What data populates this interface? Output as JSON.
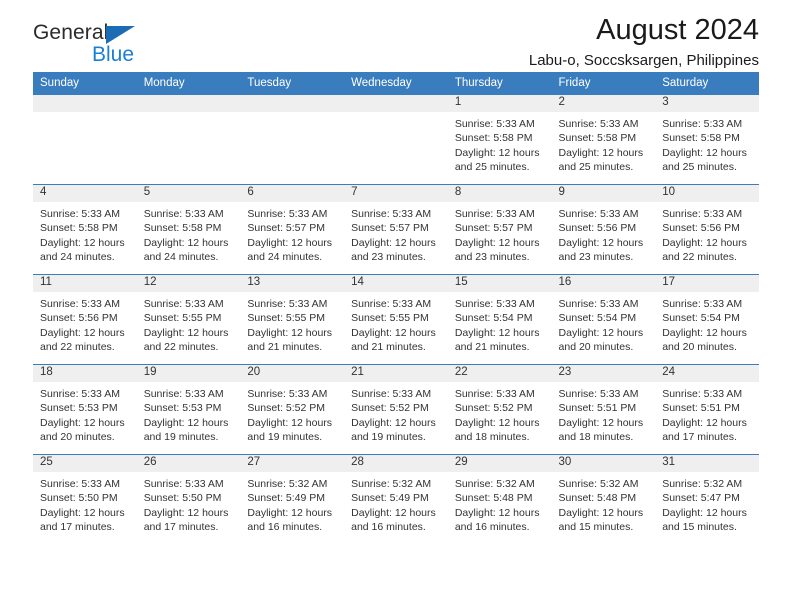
{
  "brand": {
    "name_top": "General",
    "name_bottom": "Blue",
    "triangle_color": "#1b6cb5",
    "blue_text_color": "#1b7fd4"
  },
  "header": {
    "title": "August 2024",
    "subtitle": "Labu-o, Soccsksargen, Philippines"
  },
  "theme": {
    "header_row_bg": "#3a7dbf",
    "daynum_bg": "#efefef",
    "text_color": "#333333"
  },
  "weekday_headers": [
    "Sunday",
    "Monday",
    "Tuesday",
    "Wednesday",
    "Thursday",
    "Friday",
    "Saturday"
  ],
  "weeks": [
    [
      {
        "day": "",
        "empty": true
      },
      {
        "day": "",
        "empty": true
      },
      {
        "day": "",
        "empty": true
      },
      {
        "day": "",
        "empty": true
      },
      {
        "day": "1",
        "sunrise": "Sunrise: 5:33 AM",
        "sunset": "Sunset: 5:58 PM",
        "daylight_line1": "Daylight: 12 hours",
        "daylight_line2": "and 25 minutes."
      },
      {
        "day": "2",
        "sunrise": "Sunrise: 5:33 AM",
        "sunset": "Sunset: 5:58 PM",
        "daylight_line1": "Daylight: 12 hours",
        "daylight_line2": "and 25 minutes."
      },
      {
        "day": "3",
        "sunrise": "Sunrise: 5:33 AM",
        "sunset": "Sunset: 5:58 PM",
        "daylight_line1": "Daylight: 12 hours",
        "daylight_line2": "and 25 minutes."
      }
    ],
    [
      {
        "day": "4",
        "sunrise": "Sunrise: 5:33 AM",
        "sunset": "Sunset: 5:58 PM",
        "daylight_line1": "Daylight: 12 hours",
        "daylight_line2": "and 24 minutes."
      },
      {
        "day": "5",
        "sunrise": "Sunrise: 5:33 AM",
        "sunset": "Sunset: 5:58 PM",
        "daylight_line1": "Daylight: 12 hours",
        "daylight_line2": "and 24 minutes."
      },
      {
        "day": "6",
        "sunrise": "Sunrise: 5:33 AM",
        "sunset": "Sunset: 5:57 PM",
        "daylight_line1": "Daylight: 12 hours",
        "daylight_line2": "and 24 minutes."
      },
      {
        "day": "7",
        "sunrise": "Sunrise: 5:33 AM",
        "sunset": "Sunset: 5:57 PM",
        "daylight_line1": "Daylight: 12 hours",
        "daylight_line2": "and 23 minutes."
      },
      {
        "day": "8",
        "sunrise": "Sunrise: 5:33 AM",
        "sunset": "Sunset: 5:57 PM",
        "daylight_line1": "Daylight: 12 hours",
        "daylight_line2": "and 23 minutes."
      },
      {
        "day": "9",
        "sunrise": "Sunrise: 5:33 AM",
        "sunset": "Sunset: 5:56 PM",
        "daylight_line1": "Daylight: 12 hours",
        "daylight_line2": "and 23 minutes."
      },
      {
        "day": "10",
        "sunrise": "Sunrise: 5:33 AM",
        "sunset": "Sunset: 5:56 PM",
        "daylight_line1": "Daylight: 12 hours",
        "daylight_line2": "and 22 minutes."
      }
    ],
    [
      {
        "day": "11",
        "sunrise": "Sunrise: 5:33 AM",
        "sunset": "Sunset: 5:56 PM",
        "daylight_line1": "Daylight: 12 hours",
        "daylight_line2": "and 22 minutes."
      },
      {
        "day": "12",
        "sunrise": "Sunrise: 5:33 AM",
        "sunset": "Sunset: 5:55 PM",
        "daylight_line1": "Daylight: 12 hours",
        "daylight_line2": "and 22 minutes."
      },
      {
        "day": "13",
        "sunrise": "Sunrise: 5:33 AM",
        "sunset": "Sunset: 5:55 PM",
        "daylight_line1": "Daylight: 12 hours",
        "daylight_line2": "and 21 minutes."
      },
      {
        "day": "14",
        "sunrise": "Sunrise: 5:33 AM",
        "sunset": "Sunset: 5:55 PM",
        "daylight_line1": "Daylight: 12 hours",
        "daylight_line2": "and 21 minutes."
      },
      {
        "day": "15",
        "sunrise": "Sunrise: 5:33 AM",
        "sunset": "Sunset: 5:54 PM",
        "daylight_line1": "Daylight: 12 hours",
        "daylight_line2": "and 21 minutes."
      },
      {
        "day": "16",
        "sunrise": "Sunrise: 5:33 AM",
        "sunset": "Sunset: 5:54 PM",
        "daylight_line1": "Daylight: 12 hours",
        "daylight_line2": "and 20 minutes."
      },
      {
        "day": "17",
        "sunrise": "Sunrise: 5:33 AM",
        "sunset": "Sunset: 5:54 PM",
        "daylight_line1": "Daylight: 12 hours",
        "daylight_line2": "and 20 minutes."
      }
    ],
    [
      {
        "day": "18",
        "sunrise": "Sunrise: 5:33 AM",
        "sunset": "Sunset: 5:53 PM",
        "daylight_line1": "Daylight: 12 hours",
        "daylight_line2": "and 20 minutes."
      },
      {
        "day": "19",
        "sunrise": "Sunrise: 5:33 AM",
        "sunset": "Sunset: 5:53 PM",
        "daylight_line1": "Daylight: 12 hours",
        "daylight_line2": "and 19 minutes."
      },
      {
        "day": "20",
        "sunrise": "Sunrise: 5:33 AM",
        "sunset": "Sunset: 5:52 PM",
        "daylight_line1": "Daylight: 12 hours",
        "daylight_line2": "and 19 minutes."
      },
      {
        "day": "21",
        "sunrise": "Sunrise: 5:33 AM",
        "sunset": "Sunset: 5:52 PM",
        "daylight_line1": "Daylight: 12 hours",
        "daylight_line2": "and 19 minutes."
      },
      {
        "day": "22",
        "sunrise": "Sunrise: 5:33 AM",
        "sunset": "Sunset: 5:52 PM",
        "daylight_line1": "Daylight: 12 hours",
        "daylight_line2": "and 18 minutes."
      },
      {
        "day": "23",
        "sunrise": "Sunrise: 5:33 AM",
        "sunset": "Sunset: 5:51 PM",
        "daylight_line1": "Daylight: 12 hours",
        "daylight_line2": "and 18 minutes."
      },
      {
        "day": "24",
        "sunrise": "Sunrise: 5:33 AM",
        "sunset": "Sunset: 5:51 PM",
        "daylight_line1": "Daylight: 12 hours",
        "daylight_line2": "and 17 minutes."
      }
    ],
    [
      {
        "day": "25",
        "sunrise": "Sunrise: 5:33 AM",
        "sunset": "Sunset: 5:50 PM",
        "daylight_line1": "Daylight: 12 hours",
        "daylight_line2": "and 17 minutes."
      },
      {
        "day": "26",
        "sunrise": "Sunrise: 5:33 AM",
        "sunset": "Sunset: 5:50 PM",
        "daylight_line1": "Daylight: 12 hours",
        "daylight_line2": "and 17 minutes."
      },
      {
        "day": "27",
        "sunrise": "Sunrise: 5:32 AM",
        "sunset": "Sunset: 5:49 PM",
        "daylight_line1": "Daylight: 12 hours",
        "daylight_line2": "and 16 minutes."
      },
      {
        "day": "28",
        "sunrise": "Sunrise: 5:32 AM",
        "sunset": "Sunset: 5:49 PM",
        "daylight_line1": "Daylight: 12 hours",
        "daylight_line2": "and 16 minutes."
      },
      {
        "day": "29",
        "sunrise": "Sunrise: 5:32 AM",
        "sunset": "Sunset: 5:48 PM",
        "daylight_line1": "Daylight: 12 hours",
        "daylight_line2": "and 16 minutes."
      },
      {
        "day": "30",
        "sunrise": "Sunrise: 5:32 AM",
        "sunset": "Sunset: 5:48 PM",
        "daylight_line1": "Daylight: 12 hours",
        "daylight_line2": "and 15 minutes."
      },
      {
        "day": "31",
        "sunrise": "Sunrise: 5:32 AM",
        "sunset": "Sunset: 5:47 PM",
        "daylight_line1": "Daylight: 12 hours",
        "daylight_line2": "and 15 minutes."
      }
    ]
  ]
}
